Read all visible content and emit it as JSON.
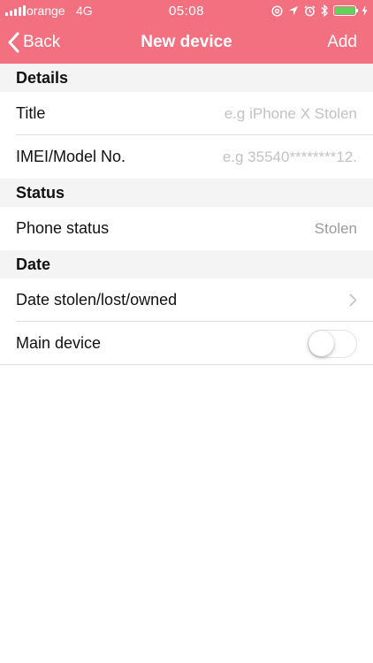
{
  "status_bar": {
    "carrier": "orange",
    "network": "4G",
    "time": "05:08",
    "battery_level": 1.0,
    "battery_color": "#5fd35a"
  },
  "nav": {
    "back_label": "Back",
    "title": "New device",
    "add_label": "Add",
    "background_color": "#f2707f"
  },
  "sections": {
    "details": {
      "header": "Details",
      "title_label": "Title",
      "title_value": "",
      "title_placeholder": "e.g iPhone X Stolen",
      "imei_label": "IMEI/Model No.",
      "imei_value": "",
      "imei_placeholder": "e.g 35540********12."
    },
    "status": {
      "header": "Status",
      "phone_status_label": "Phone status",
      "phone_status_value": "Stolen"
    },
    "date": {
      "header": "Date",
      "date_label": "Date stolen/lost/owned",
      "main_device_label": "Main device",
      "main_device_on": false
    }
  },
  "icons": {
    "back": "chevron-left-icon",
    "disclosure": "chevron-right-icon",
    "status": [
      "signal-icon",
      "at-icon",
      "location-icon",
      "alarm-icon",
      "bluetooth-icon",
      "battery-icon",
      "charging-icon"
    ]
  }
}
